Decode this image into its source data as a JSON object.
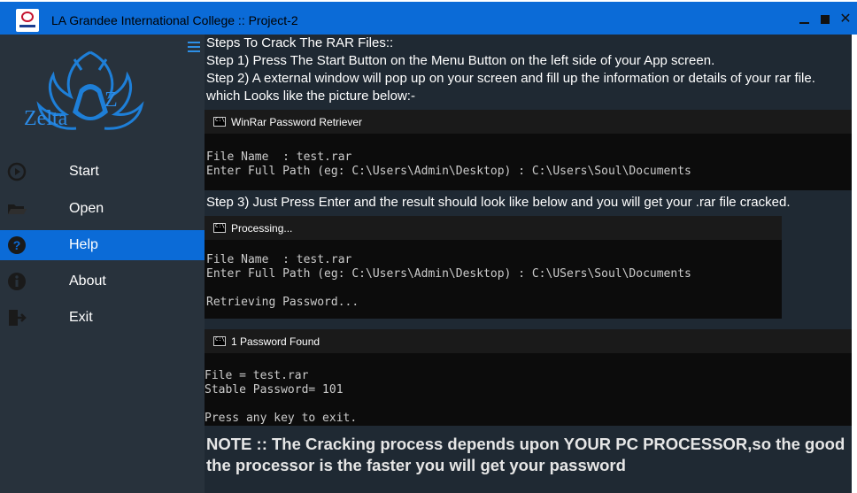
{
  "window": {
    "title": "LA Grandee International College :: Project-2",
    "minimize": "",
    "maximize": "",
    "close": "✕"
  },
  "sidebar": {
    "logo_text": "Zelta",
    "logo_letter": "Z",
    "items": [
      {
        "label": "Start",
        "icon": "play-circle-icon",
        "active": false
      },
      {
        "label": "Open",
        "icon": "folder-open-icon",
        "active": false
      },
      {
        "label": "Help",
        "icon": "question-circle-icon",
        "active": true
      },
      {
        "label": "About",
        "icon": "info-circle-icon",
        "active": false
      },
      {
        "label": "Exit",
        "icon": "exit-door-icon",
        "active": false
      }
    ]
  },
  "main": {
    "heading": "Steps To Crack The RAR Files::",
    "step1": "Step 1) Press The Start Button on the Menu Button on the left side of your App screen.",
    "step2a": "Step 2) A external window will pop up on your screen and fill up the information or details of your rar file.",
    "step2b": "which Looks like the picture below:-",
    "step3": "Step 3) Just Press Enter and the result should look like below and you will get your .rar file cracked.",
    "note": "NOTE :: The Cracking process depends upon YOUR PC PROCESSOR,so the good the processor is the faster you will get your password"
  },
  "consoles": [
    {
      "title": "WinRar Password Retriever",
      "lines": [
        "File Name  : test.rar",
        "Enter Full Path (eg: C:\\Users\\Admin\\Desktop) : C:\\Users\\Soul\\Documents"
      ]
    },
    {
      "title": "Processing...",
      "lines": [
        "File Name  : test.rar",
        "Enter Full Path (eg: C:\\Users\\Admin\\Desktop) : C:\\USers\\Soul\\Documents",
        "",
        "Retrieving Password..."
      ]
    },
    {
      "title": "1 Password Found",
      "lines": [
        "File = test.rar",
        "Stable Password= 101",
        "",
        "Press any key to exit."
      ]
    }
  ],
  "colors": {
    "accent": "#0b6bd7",
    "sidebar": "#28323c",
    "content": "#1f2933",
    "console": "#0c0c0c"
  }
}
